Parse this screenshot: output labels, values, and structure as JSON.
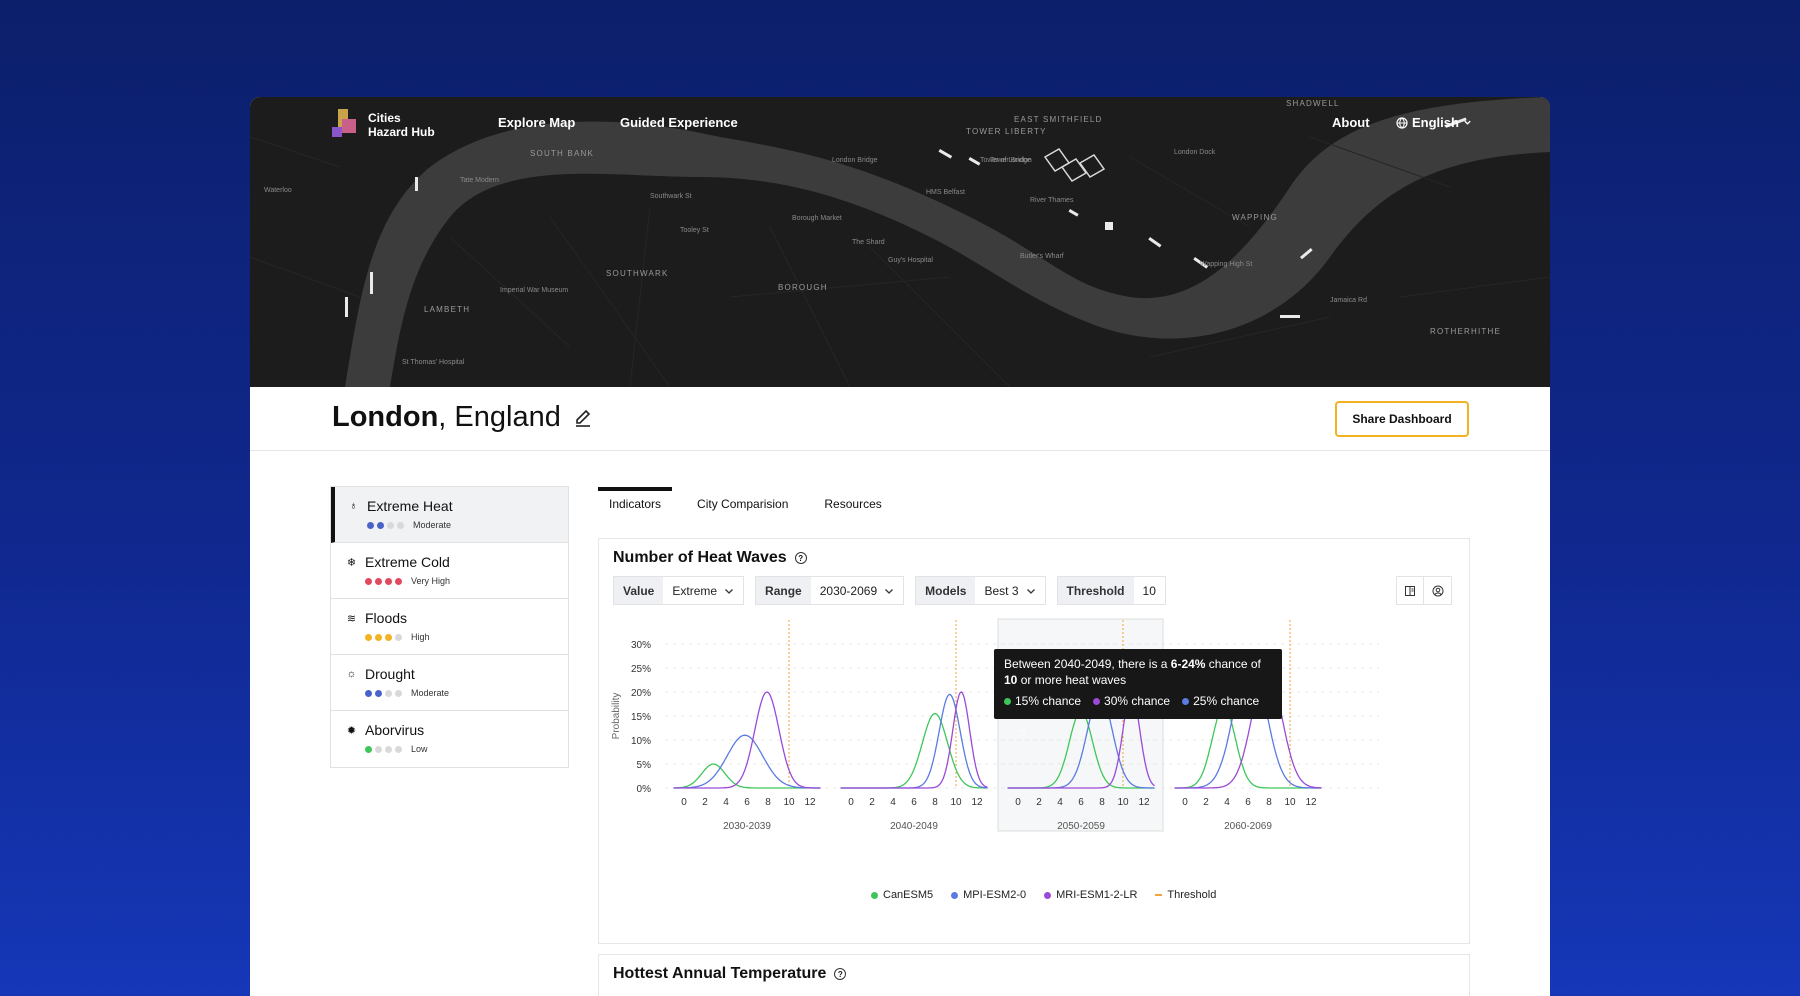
{
  "app": {
    "logo_text_line1": "Cities",
    "logo_text_line2": "Hazard Hub",
    "nav": [
      "Explore Map",
      "Guided Experience",
      "About"
    ],
    "language": "English"
  },
  "map_labels": {
    "districts": [
      "SOUTH BANK",
      "SOUTHWARK",
      "BOROUGH",
      "LAMBETH",
      "WAPPING",
      "ROTHERHITHE",
      "EAST SMITHFIELD",
      "TOWER LIBERTY",
      "SHADWELL"
    ],
    "places": [
      "London Bridge",
      "Tower Bridge",
      "River Thames",
      "HMS Belfast",
      "Butler's Wharf",
      "Tate Modern",
      "Borough Market",
      "The Shard",
      "Guy's Hospital",
      "Waterloo",
      "Imperial War Museum",
      "St Thomas' Hospital",
      "Tower of London",
      "London Dock",
      "Wapping High St",
      "Southwark St",
      "Tooley St",
      "Jamaica Rd"
    ]
  },
  "header": {
    "city": "London",
    "region": ", England",
    "share_label": "Share Dashboard"
  },
  "sidebar": {
    "items": [
      {
        "label": "Extreme Heat",
        "level": "Moderate",
        "icon": "flame-icon",
        "glyph": "♁",
        "filled": 2,
        "color": "#4a63c9",
        "active": true
      },
      {
        "label": "Extreme Cold",
        "level": "Very High",
        "icon": "snowflake-icon",
        "glyph": "❄",
        "filled": 4,
        "color": "#e04a5f",
        "active": false
      },
      {
        "label": "Floods",
        "level": "High",
        "icon": "flood-icon",
        "glyph": "≋",
        "filled": 3,
        "color": "#f2b322",
        "active": false
      },
      {
        "label": "Drought",
        "level": "Moderate",
        "icon": "sun-icon",
        "glyph": "☼",
        "filled": 2,
        "color": "#4a63c9",
        "active": false
      },
      {
        "label": "Aborvirus",
        "level": "Low",
        "icon": "virus-icon",
        "glyph": "✹",
        "filled": 1,
        "color": "#3ec65a",
        "active": false
      }
    ]
  },
  "tabs": [
    "Indicators",
    "City Comparision",
    "Resources"
  ],
  "panel": {
    "title": "Number of Heat Waves",
    "filters": [
      {
        "label": "Value",
        "value": "Extreme",
        "dropdown": true
      },
      {
        "label": "Range",
        "value": "2030-2069",
        "dropdown": true
      },
      {
        "label": "Models",
        "value": "Best 3",
        "dropdown": true
      },
      {
        "label": "Threshold",
        "value": "10",
        "dropdown": false
      }
    ],
    "tooltip": {
      "prefix": "Between 2040-2049, there is a ",
      "range": "6-24%",
      "middle": " chance of",
      "count": "10",
      "suffix": " or more heat waves",
      "chances": [
        {
          "label": "15% chance",
          "color": "#3ec65a"
        },
        {
          "label": "30% chance",
          "color": "#9b4ad8"
        },
        {
          "label": "25% chance",
          "color": "#5b7be0"
        }
      ]
    }
  },
  "chart_data": {
    "type": "line",
    "ylabel": "Probability",
    "yticks": [
      "0%",
      "5%",
      "10%",
      "15%",
      "20%",
      "25%",
      "30%"
    ],
    "ylim": [
      0,
      30
    ],
    "xticks": [
      0,
      2,
      4,
      6,
      8,
      10,
      12
    ],
    "xlim": [
      -1,
      13
    ],
    "threshold": 10,
    "facets": [
      {
        "label": "2030-2039",
        "series": [
          {
            "name": "CanESM5",
            "color": "#3ec65a",
            "mean": 2.8,
            "sd": 1.1,
            "peak": 5
          },
          {
            "name": "MPI-ESM2-0",
            "color": "#5b7be0",
            "mean": 5.8,
            "sd": 1.7,
            "peak": 11
          },
          {
            "name": "MRI-ESM1-2-LR",
            "color": "#9b4ad8",
            "mean": 7.9,
            "sd": 1.15,
            "peak": 20
          }
        ]
      },
      {
        "label": "2040-2049",
        "series": [
          {
            "name": "CanESM5",
            "color": "#3ec65a",
            "mean": 8.0,
            "sd": 1.2,
            "peak": 15.5
          },
          {
            "name": "MPI-ESM2-0",
            "color": "#5b7be0",
            "mean": 9.4,
            "sd": 1.0,
            "peak": 19.5
          },
          {
            "name": "MRI-ESM1-2-LR",
            "color": "#9b4ad8",
            "mean": 10.5,
            "sd": 0.8,
            "peak": 20
          }
        ]
      },
      {
        "label": "2050-2059",
        "series": [
          {
            "name": "CanESM5",
            "color": "#3ec65a",
            "mean": 6.0,
            "sd": 1.1,
            "peak": 16
          },
          {
            "name": "MPI-ESM2-0",
            "color": "#5b7be0",
            "mean": 7.8,
            "sd": 1.2,
            "peak": 19.5
          },
          {
            "name": "MRI-ESM1-2-LR",
            "color": "#9b4ad8",
            "mean": 10.8,
            "sd": 0.8,
            "peak": 20
          }
        ]
      },
      {
        "label": "2060-2069",
        "series": [
          {
            "name": "CanESM5",
            "color": "#3ec65a",
            "mean": 3.7,
            "sd": 1.1,
            "peak": 17
          },
          {
            "name": "MPI-ESM2-0",
            "color": "#5b7be0",
            "mean": 6.2,
            "sd": 1.5,
            "peak": 27.5
          },
          {
            "name": "MRI-ESM1-2-LR",
            "color": "#9b4ad8",
            "mean": 7.8,
            "sd": 1.4,
            "peak": 25
          }
        ]
      }
    ],
    "highlight_facet": "2040-2049",
    "legend": [
      {
        "name": "CanESM5",
        "color": "#3ec65a"
      },
      {
        "name": "MPI-ESM2-0",
        "color": "#5b7be0"
      },
      {
        "name": "MRI-ESM1-2-LR",
        "color": "#9b4ad8"
      },
      {
        "name": "Threshold",
        "color": "#f2a33a"
      }
    ]
  },
  "panel2": {
    "title": "Hottest Annual Temperature"
  }
}
